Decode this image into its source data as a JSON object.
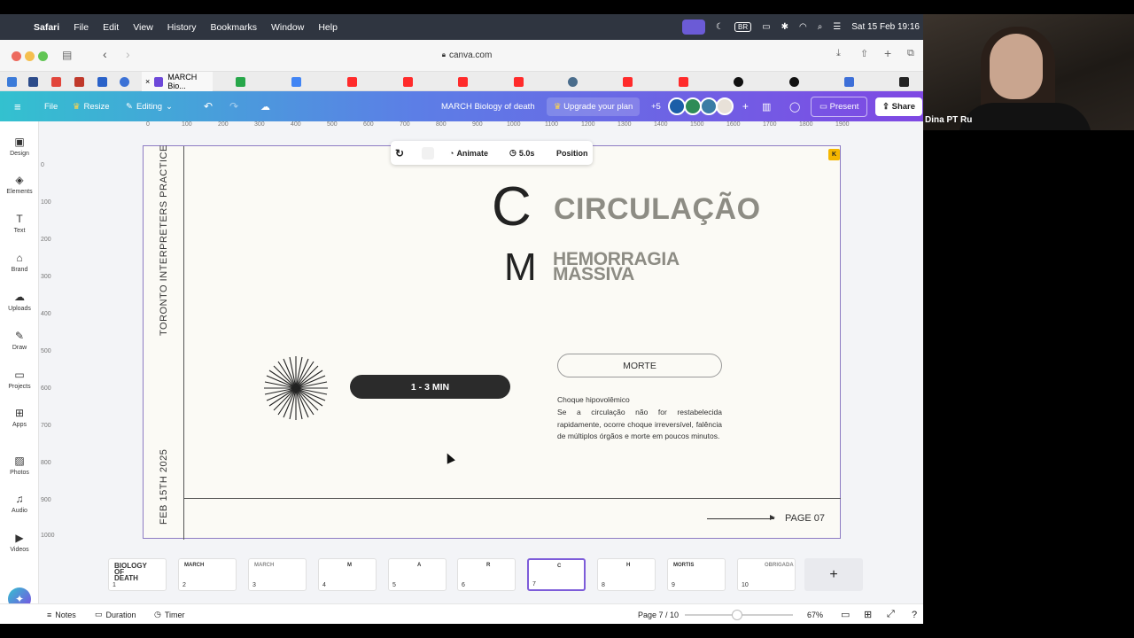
{
  "menubar": {
    "app": "Safari",
    "items": [
      "File",
      "Edit",
      "View",
      "History",
      "Bookmarks",
      "Window",
      "Help"
    ],
    "keyboard": "BR",
    "datetime": "Sat 15 Feb  19:16"
  },
  "browser": {
    "url": "canva.com",
    "active_tab": "MARCH Bio..."
  },
  "canva_topbar": {
    "file": "File",
    "resize": "Resize",
    "editing": "Editing",
    "doc_title": "MARCH Biology of death",
    "upgrade": "Upgrade your plan",
    "collab_count": "+5",
    "present": "Present",
    "share": "Share"
  },
  "left_panel": {
    "items": [
      {
        "label": "Design",
        "icon": "design-icon"
      },
      {
        "label": "Elements",
        "icon": "elements-icon"
      },
      {
        "label": "Text",
        "icon": "text-icon"
      },
      {
        "label": "Brand",
        "icon": "brand-icon"
      },
      {
        "label": "Uploads",
        "icon": "uploads-icon"
      },
      {
        "label": "Draw",
        "icon": "draw-icon"
      },
      {
        "label": "Projects",
        "icon": "projects-icon"
      },
      {
        "label": "Apps",
        "icon": "apps-icon"
      },
      {
        "label": "Photos",
        "icon": "photos-icon"
      },
      {
        "label": "Audio",
        "icon": "audio-icon"
      },
      {
        "label": "Videos",
        "icon": "videos-icon"
      }
    ]
  },
  "rulers": {
    "h_ticks": [
      "0",
      "100",
      "200",
      "300",
      "400",
      "500",
      "600",
      "700",
      "800",
      "900",
      "1000",
      "1100",
      "1200",
      "1300",
      "1400",
      "1500",
      "1600",
      "1700",
      "1800",
      "1900"
    ],
    "v_ticks": [
      "0",
      "100",
      "200",
      "300",
      "400",
      "500",
      "600",
      "700",
      "800",
      "900",
      "1000"
    ]
  },
  "floating_toolbar": {
    "animate": "Animate",
    "duration": "5.0s",
    "position": "Position"
  },
  "slide": {
    "side_top": "TORONTO INTERPRETERS PRACTICE",
    "side_bottom": "FEB 15TH 2025",
    "letter_c": "C",
    "letter_m": "M",
    "circulacao": "CIRCULAÇÃO",
    "hemorragia_line1": "HEMORRAGIA",
    "hemorragia_line2": "MASSIVA",
    "time_pill": "1 - 3 MIN",
    "morte": "MORTE",
    "body_title": "Choque hipovolêmico",
    "body_text": "Se a circulação não for restabelecida rapidamente, ocorre choque irreversível, falência de múltiplos órgãos e morte em poucos minutos.",
    "page": "PAGE 07",
    "badge": "K"
  },
  "thumbnails": [
    {
      "n": "1",
      "title": "BIOLOGY OF DEATH"
    },
    {
      "n": "2",
      "title": "MARCH"
    },
    {
      "n": "3",
      "title": "MARCH"
    },
    {
      "n": "4",
      "title": "M"
    },
    {
      "n": "5",
      "title": "A"
    },
    {
      "n": "6",
      "title": "R"
    },
    {
      "n": "7",
      "title": "C"
    },
    {
      "n": "8",
      "title": "H"
    },
    {
      "n": "9",
      "title": "MORTIS"
    },
    {
      "n": "10",
      "title": "OBRIGADA"
    }
  ],
  "bottombar": {
    "notes": "Notes",
    "duration": "Duration",
    "timer": "Timer",
    "page_indicator": "Page 7 / 10",
    "zoom": "67%"
  },
  "webcam": {
    "name": "Dina PT Ru"
  },
  "colors": {
    "accent": "#7d5cd9",
    "gray_title": "#8d8c84",
    "slide_bg": "#fbfaf5"
  }
}
